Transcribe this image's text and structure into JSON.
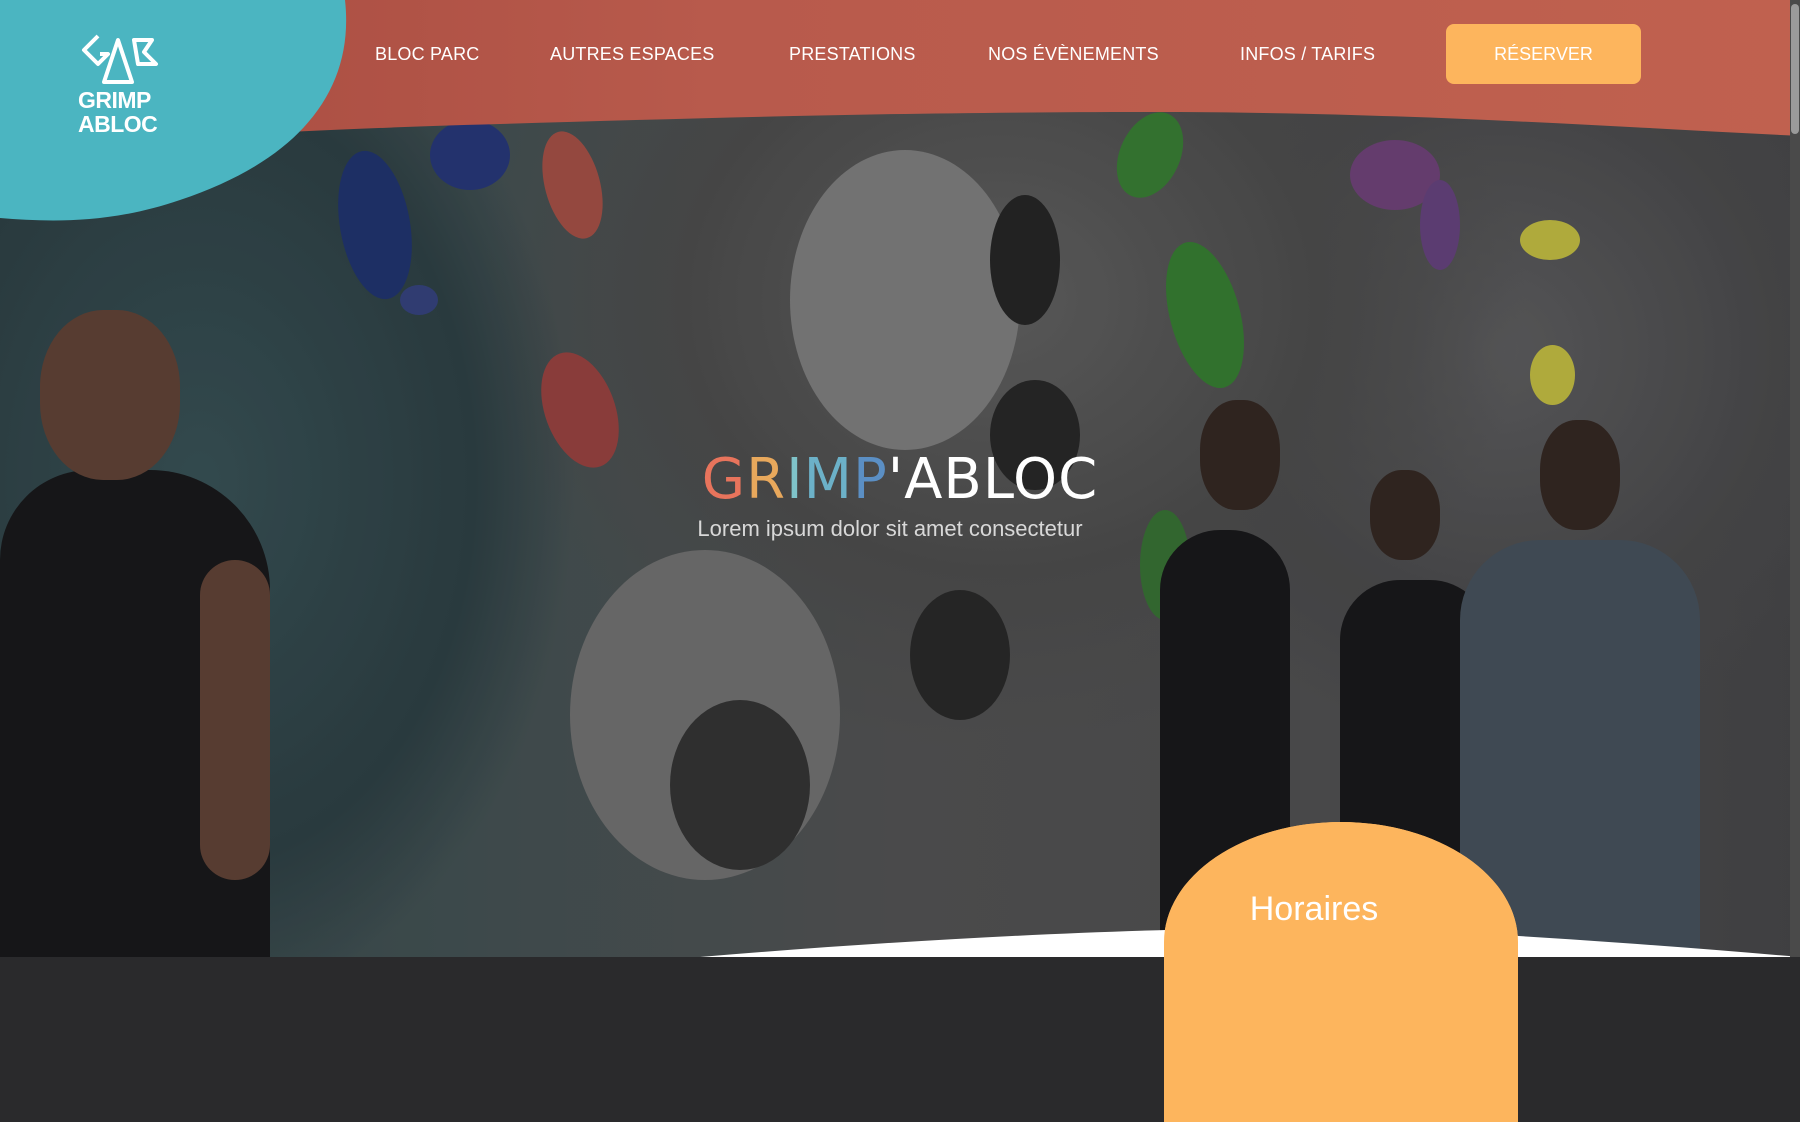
{
  "brand": {
    "logo_line1": "GRIMP",
    "logo_line2": "ABLOC",
    "logo_monogram": "GAB"
  },
  "nav": {
    "items": [
      {
        "label": "BLOC PARC"
      },
      {
        "label": "AUTRES ESPACES"
      },
      {
        "label": "PRESTATIONS"
      },
      {
        "label": "NOS ÉVÈNEMENTS"
      },
      {
        "label": "INFOS / TARIFS"
      }
    ],
    "cta_label": "RÉSERVER"
  },
  "hero": {
    "title_letters": [
      {
        "char": "G",
        "color": "#e8745c"
      },
      {
        "char": "R",
        "color": "#e8a85c"
      },
      {
        "char": "I",
        "color": "#7fc3c9"
      },
      {
        "char": "M",
        "color": "#6cb1c8"
      },
      {
        "char": "P",
        "color": "#5b8fc4"
      },
      {
        "char": "'ABLOC",
        "color": "#ffffff"
      }
    ],
    "subtitle": "Lorem ipsum dolor sit amet consectetur"
  },
  "horaires": {
    "label": "Horaires"
  },
  "colors": {
    "nav_bg": "#b5574a",
    "logo_blob": "#4bb5c1",
    "accent": "#fdb55d"
  }
}
